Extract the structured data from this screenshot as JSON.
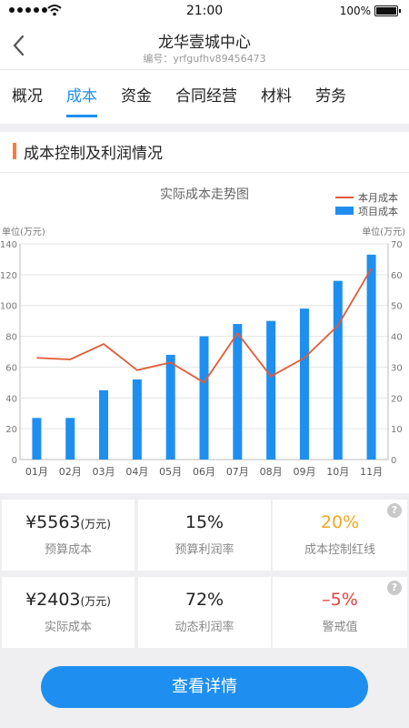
{
  "status_bar": {
    "time": "21:00",
    "battery": "100%"
  },
  "header": {
    "title": "龙华壹城中心",
    "subtitle": "编号：yrfgufhv89456473"
  },
  "tabs": [
    {
      "label": "概况"
    },
    {
      "label": "成本",
      "active": true
    },
    {
      "label": "资金"
    },
    {
      "label": "合同经营"
    },
    {
      "label": "材料"
    },
    {
      "label": "劳务"
    }
  ],
  "section": {
    "title": "成本控制及利润情况"
  },
  "chart_data": {
    "type": "bar+line",
    "title": "实际成本走势图",
    "legend": [
      "本月成本",
      "项目成本"
    ],
    "left_unit": "单位(万元)",
    "right_unit": "单位(万元)",
    "categories": [
      "01月",
      "02月",
      "03月",
      "04月",
      "05月",
      "06月",
      "07月",
      "08月",
      "09月",
      "10月",
      "11月"
    ],
    "series": [
      {
        "name": "项目成本",
        "type": "bar",
        "axis": "left",
        "color": "#1e8ff0",
        "values": [
          27,
          27,
          45,
          52,
          68,
          80,
          88,
          90,
          98,
          116,
          133
        ]
      },
      {
        "name": "本月成本",
        "type": "line",
        "axis": "right",
        "color": "#e25b35",
        "values": [
          33,
          32.5,
          37.5,
          29,
          31.5,
          25,
          41,
          27,
          33,
          43.5,
          62
        ]
      }
    ],
    "left_ylim": [
      0,
      140
    ],
    "left_ticks": [
      "0",
      "20",
      "40",
      "60",
      "80",
      "100",
      "120",
      "140"
    ],
    "right_ylim": [
      0,
      70
    ],
    "right_ticks": [
      "0",
      "10",
      "20",
      "30",
      "40",
      "50",
      "60",
      "70"
    ],
    "grid": true
  },
  "kpis": {
    "budget_cost": {
      "value": "¥5563",
      "unit": "(万元)",
      "label": "预算成本"
    },
    "budget_margin": {
      "value": "15%",
      "label": "预算利润率"
    },
    "cost_redline": {
      "value": "20%",
      "label": "成本控制红线",
      "help": "?"
    },
    "actual_cost": {
      "value": "¥2403",
      "unit": "(万元)",
      "label": "实际成本"
    },
    "dynamic_margin": {
      "value": "72%",
      "label": "动态利润率"
    },
    "warning_value": {
      "value": "–5%",
      "label": "警戒值",
      "help": "?"
    }
  },
  "footer": {
    "button_label": "查看详情"
  },
  "colors": {
    "accent": "#1e8ff0",
    "line": "#e25b35",
    "section_bar": "#ff7a3d",
    "warn": "#f5a623",
    "alert": "#e8413e"
  }
}
